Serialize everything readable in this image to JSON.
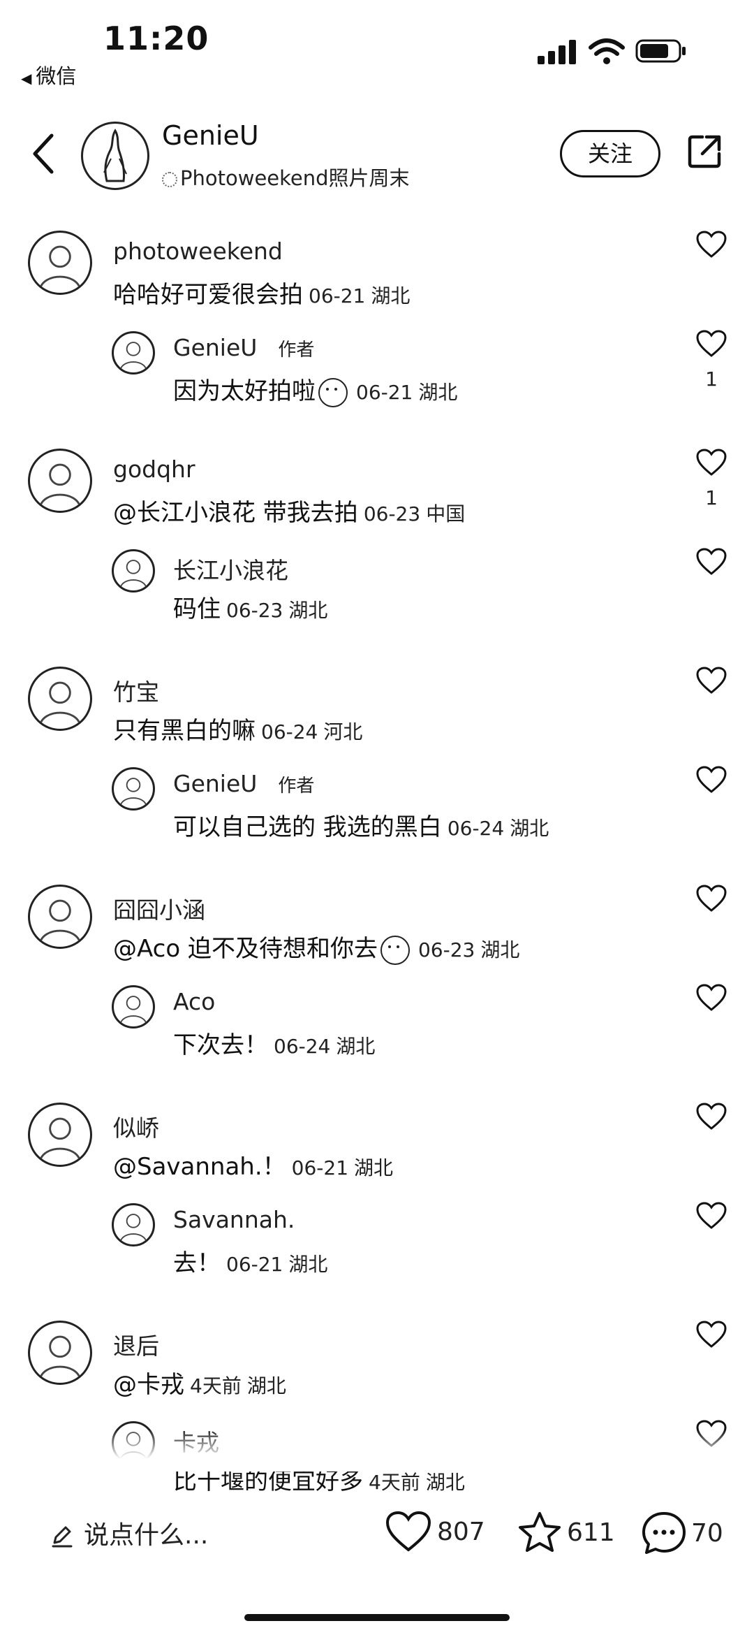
{
  "status_bar": {
    "time": "11:20",
    "back_app": "微信"
  },
  "header": {
    "author_name": "GenieU",
    "author_subtitle": "Photoweekend照片周末",
    "follow_label": "关注"
  },
  "comments": [
    {
      "name": "photoweekend",
      "text": "哈哈好可爱很会拍",
      "date": "06-21",
      "location": "湖北",
      "like_count": ""
    },
    {
      "name": "GenieU",
      "author_tag": "作者",
      "text": "因为太好拍啦",
      "date": "06-21",
      "location": "湖北",
      "like_count": "1"
    },
    {
      "name": "godqhr",
      "text": "@长江小浪花 带我去拍",
      "date": "06-23",
      "location": "中国",
      "like_count": "1"
    },
    {
      "name": "长江小浪花",
      "text": "码住",
      "date": "06-23",
      "location": "湖北",
      "like_count": ""
    },
    {
      "name": "竹宝",
      "text": "只有黑白的嘛",
      "date": "06-24",
      "location": "河北",
      "like_count": ""
    },
    {
      "name": "GenieU",
      "author_tag": "作者",
      "text": "可以自己选的 我选的黑白",
      "date": "06-24",
      "location": "湖北",
      "like_count": ""
    },
    {
      "name": "囧囧小涵",
      "text": "@Aco 迫不及待想和你去",
      "date": "06-23",
      "location": "湖北",
      "like_count": ""
    },
    {
      "name": "Aco",
      "text": "下次去！",
      "date": "06-24",
      "location": "湖北",
      "like_count": ""
    },
    {
      "name": "似峤",
      "text": "@Savannah.！",
      "date": "06-21",
      "location": "湖北",
      "like_count": ""
    },
    {
      "name": "Savannah.",
      "text": "去！",
      "date": "06-21",
      "location": "湖北",
      "like_count": ""
    },
    {
      "name": "退后",
      "text": "@卡戎",
      "date": "4天前",
      "location": "湖北",
      "like_count": ""
    },
    {
      "name": "卡戎",
      "text": "比十堰的便宜好多",
      "date": "4天前",
      "location": "湖北",
      "like_count": ""
    }
  ],
  "footer": {
    "input_placeholder": "说点什么...",
    "likes": "807",
    "favorites": "611",
    "comments": "70"
  }
}
